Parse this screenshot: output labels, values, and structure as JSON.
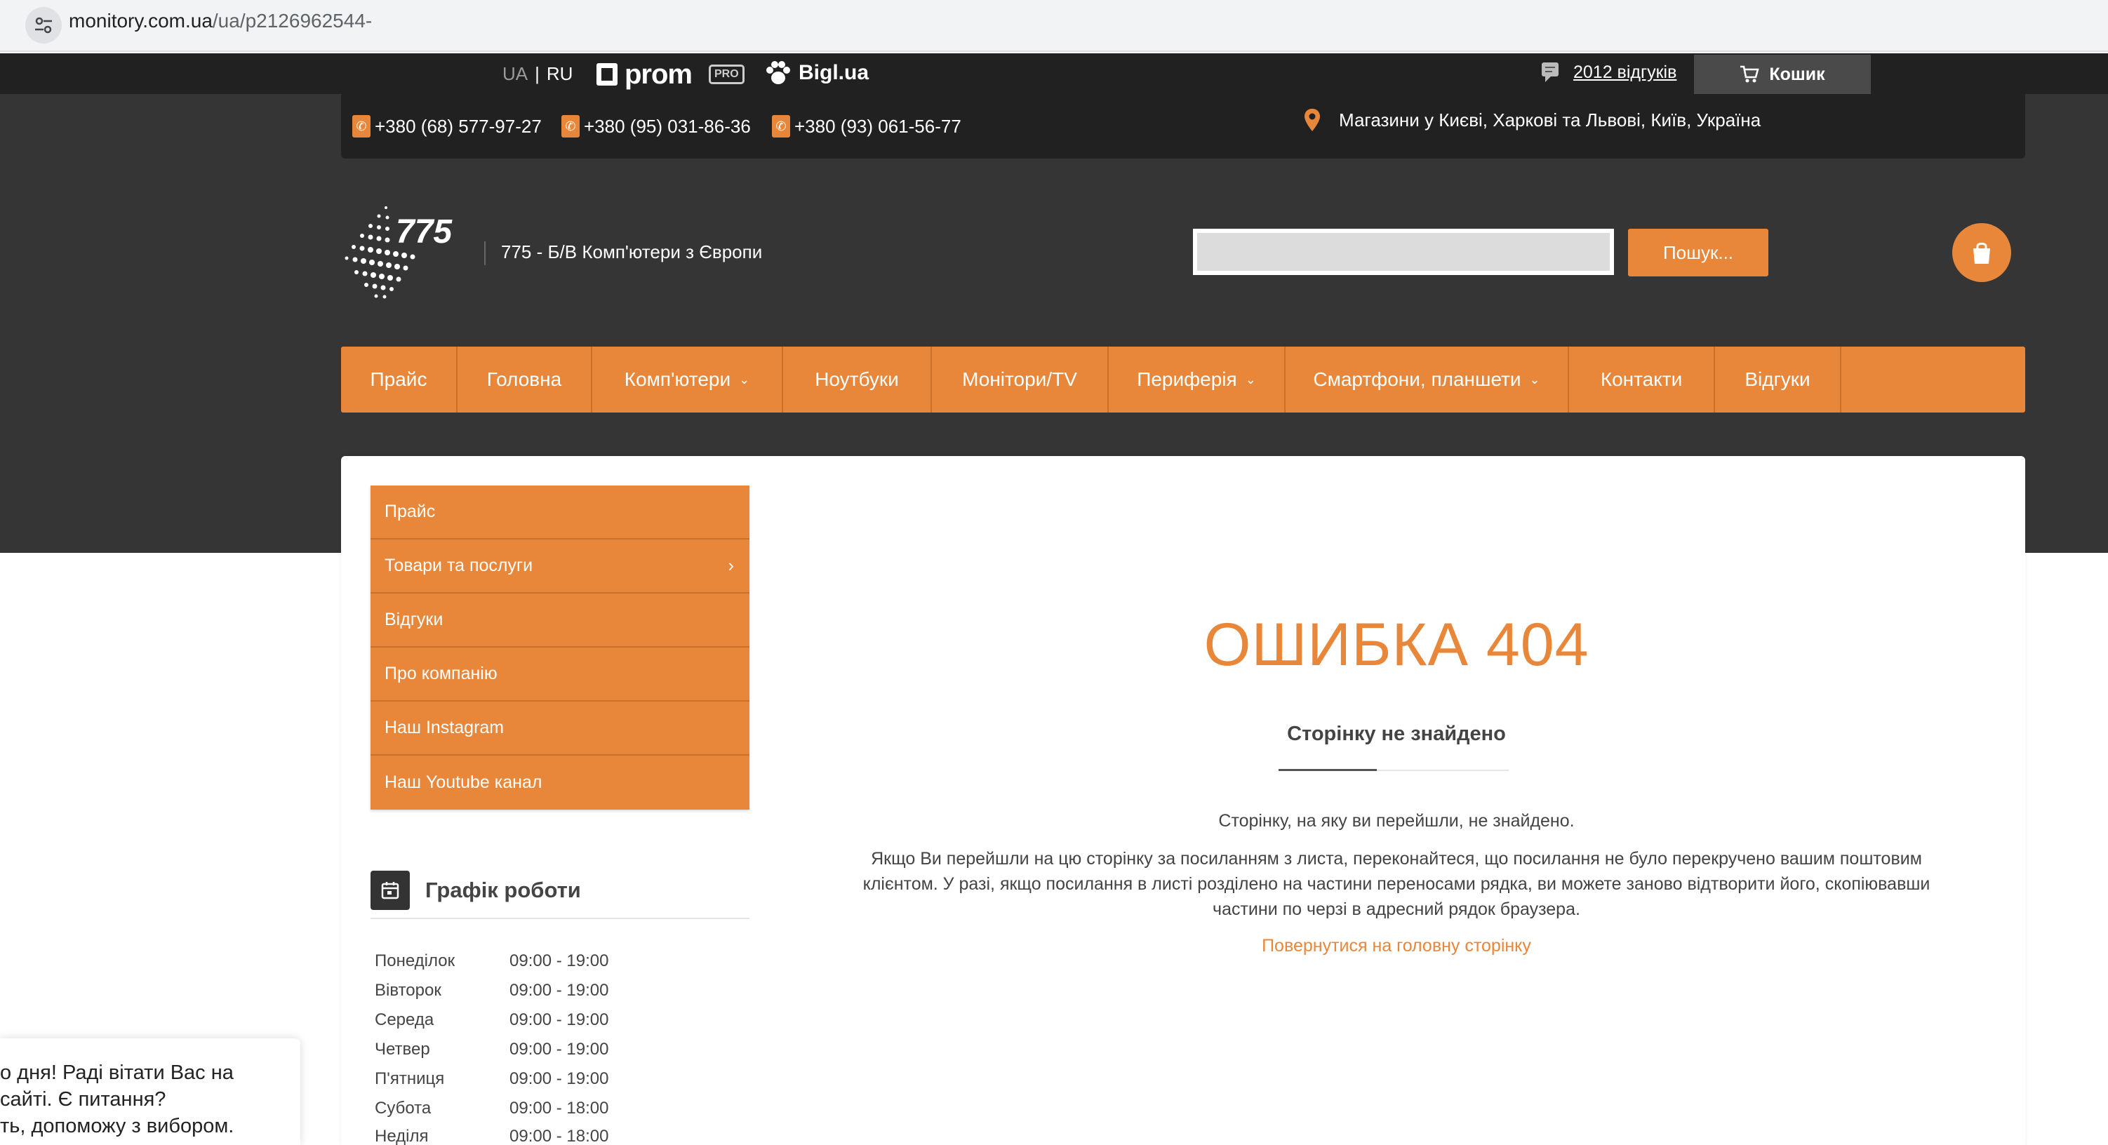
{
  "browser": {
    "url_domain": "monitory.com.ua",
    "url_path": "/ua/p2126962544-"
  },
  "topbar": {
    "lang_ua": "UA",
    "lang_ru": "RU",
    "prom": "prom",
    "pro_badge": "PRO",
    "bigl": "Bigl.ua",
    "reviews": "2012 відгуків",
    "cart": "Кошик"
  },
  "contacts": {
    "phones": [
      "+380 (68) 577-97-27",
      "+380 (95) 031-86-36",
      "+380 (93) 061-56-77"
    ],
    "address": "Магазини у Києві, Харкові та Львові, Київ, Україна"
  },
  "header": {
    "logo_text": "775",
    "tagline": "775 - Б/В Комп'ютери з Європи",
    "search_placeholder": "",
    "search_button": "Пошук..."
  },
  "nav": {
    "items": [
      {
        "label": "Прайс",
        "dropdown": false
      },
      {
        "label": "Головна",
        "dropdown": false
      },
      {
        "label": "Комп'ютери",
        "dropdown": true
      },
      {
        "label": "Ноутбуки",
        "dropdown": false
      },
      {
        "label": "Монітори/TV",
        "dropdown": false
      },
      {
        "label": "Периферія",
        "dropdown": true
      },
      {
        "label": "Смартфони, планшети",
        "dropdown": true
      },
      {
        "label": "Контакти",
        "dropdown": false
      },
      {
        "label": "Відгуки",
        "dropdown": false
      }
    ]
  },
  "sidebar": {
    "items": [
      {
        "label": "Прайс"
      },
      {
        "label": "Товари та послуги"
      },
      {
        "label": "Відгуки"
      },
      {
        "label": "Про компанію"
      },
      {
        "label": "Наш Instagram"
      },
      {
        "label": "Наш Youtube канал"
      }
    ],
    "schedule_title": "Графік роботи",
    "schedule": [
      {
        "day": "Понеділок",
        "hours": "09:00 - 19:00"
      },
      {
        "day": "Вівторок",
        "hours": "09:00 - 19:00"
      },
      {
        "day": "Середа",
        "hours": "09:00 - 19:00"
      },
      {
        "day": "Четвер",
        "hours": "09:00 - 19:00"
      },
      {
        "day": "П'ятниця",
        "hours": "09:00 - 19:00"
      },
      {
        "day": "Субота",
        "hours": "09:00 - 18:00"
      },
      {
        "day": "Неділя",
        "hours": "09:00 - 18:00"
      }
    ]
  },
  "error": {
    "title": "ОШИБКА 404",
    "subtitle": "Сторінку не знайдено",
    "p1": "Сторінку, на яку ви перейшли, не знайдено.",
    "p2": "Якщо Ви перейшли на цю сторінку за посиланням з листа, переконайтеся, що посилання не було перекручено вашим поштовим клієнтом. У разі, якщо посилання в листі розділено на частини переносами рядка, ви можете заново відтворити його, скопіювавши частини по черзі в адресний рядок браузера.",
    "link": "Повернутися на головну сторінку"
  },
  "chat": {
    "line1": "о дня! Раді вітати Вас на",
    "line2": "сайті. Є питання?",
    "line3": "ть, допоможу з вибором."
  },
  "colors": {
    "accent": "#e8873a",
    "dark": "#353535",
    "darker": "#212121"
  }
}
